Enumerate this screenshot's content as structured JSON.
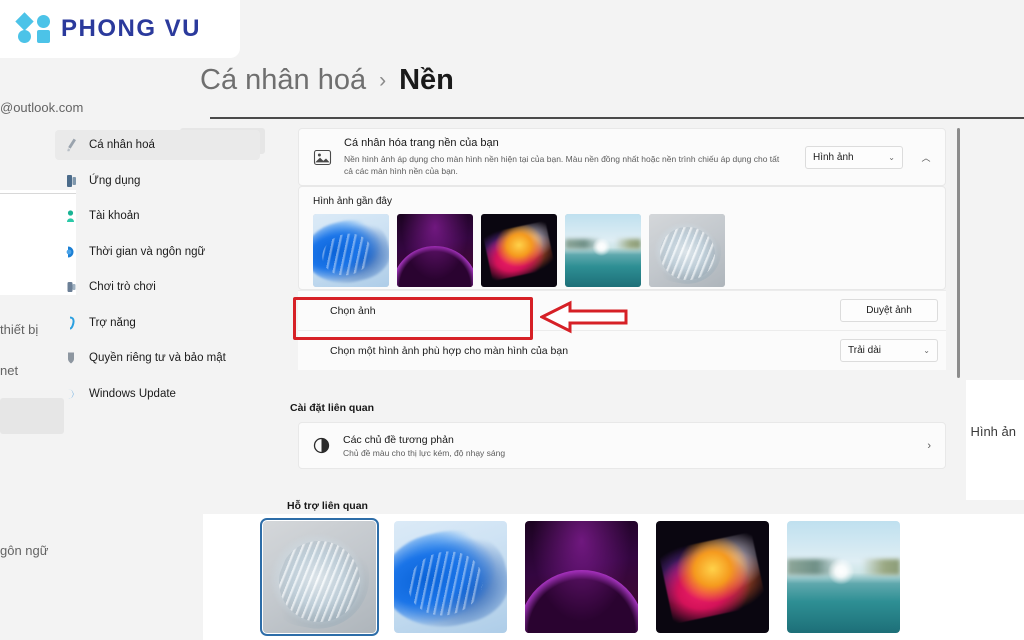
{
  "brand": {
    "name": "PHONG VU",
    "logo_color": "#4cc3e8",
    "text_color": "#2b3a9c"
  },
  "background_window": {
    "email_fragment": "@outlook.com",
    "ghost_left_1": "thiết bị",
    "ghost_left_2": "net",
    "ghost_left_3": "gôn ngữ",
    "edge_label": "Hình ản"
  },
  "breadcrumb": {
    "parent": "Cá nhân hoá",
    "separator": "›",
    "current": "Nền"
  },
  "sidebar": {
    "items": [
      {
        "label": "Cá nhân hoá",
        "icon": "brush-icon",
        "active": true
      },
      {
        "label": "Ứng dụng",
        "icon": "apps-icon",
        "active": false
      },
      {
        "label": "Tài khoản",
        "icon": "account-icon",
        "active": false
      },
      {
        "label": "Thời gian và ngôn ngữ",
        "icon": "clock-language-icon",
        "active": false
      },
      {
        "label": "Chơi trò chơi",
        "icon": "gaming-icon",
        "active": false
      },
      {
        "label": "Trợ năng",
        "icon": "accessibility-icon",
        "active": false
      },
      {
        "label": "Quyền riêng tư và bảo mật",
        "icon": "shield-icon",
        "active": false
      },
      {
        "label": "Windows Update",
        "icon": "update-icon",
        "active": false
      }
    ]
  },
  "main": {
    "personalize": {
      "icon": "picture-icon",
      "title": "Cá nhân hóa trang nền của bạn",
      "description": "Nền hình ảnh áp dụng cho màn hình nền hiện tại của bạn. Màu nền đồng nhất hoặc nền trình chiếu áp dụng cho tất cả các màn hình nền của bạn.",
      "dropdown_value": "Hình ảnh",
      "expand_state": "expanded"
    },
    "recent": {
      "label": "Hình ảnh gần đây",
      "thumbnails": [
        {
          "name": "bloom-blue",
          "style": "wp-bloom-blue"
        },
        {
          "name": "purple-glow",
          "style": "wp-glow"
        },
        {
          "name": "flower-dark",
          "style": "wp-flower"
        },
        {
          "name": "lake-sunrise",
          "style": "wp-lake"
        },
        {
          "name": "silver-bloom",
          "style": "wp-silver"
        }
      ]
    },
    "choose_picture": {
      "label": "Chọn ảnh",
      "button_label": "Duyệt ảnh",
      "highlighted": true
    },
    "fit_picture": {
      "label": "Chọn một hình ảnh phù hợp cho màn hình của bạn",
      "dropdown_value": "Trải dài"
    },
    "related_settings": {
      "heading": "Cài đặt liên quan",
      "item": {
        "icon": "contrast-icon",
        "title": "Các chủ đề tương phản",
        "subtitle": "Chủ đề màu cho thị lực kém, độ nhạy sáng",
        "chevron": "›"
      }
    },
    "related_support": {
      "heading": "Hỗ trợ liên quan"
    }
  },
  "wallpaper_strip": {
    "tiles": [
      {
        "name": "silver-bloom",
        "style": "wp-silver",
        "selected": true
      },
      {
        "name": "bloom-blue",
        "style": "wp-bloom-blue",
        "selected": false
      },
      {
        "name": "purple-glow",
        "style": "wp-glow",
        "selected": false
      },
      {
        "name": "flower-dark",
        "style": "wp-flower",
        "selected": false
      },
      {
        "name": "lake-sunrise",
        "style": "wp-lake",
        "selected": false
      }
    ]
  },
  "annotation": {
    "box_color": "#d62026",
    "arrow_color": "#d62026",
    "arrow_direction": "left"
  }
}
